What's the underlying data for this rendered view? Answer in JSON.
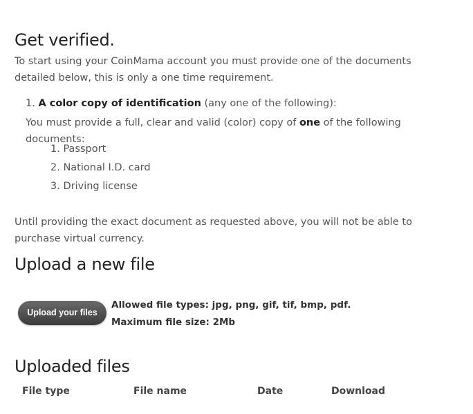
{
  "verify": {
    "title": "Get verified.",
    "intro": "To start using your CoinMama account you must provide one of the documents detailed below, this is only a one time requirement.",
    "requirement": {
      "number": "1.",
      "heading": "A color copy of identification",
      "heading_suffix": " (any one of the following):",
      "line_prefix": "You must provide a full, clear and valid (color) copy of ",
      "line_emphasis": "one",
      "line_suffix": " of the following documents:"
    },
    "documents": [
      {
        "number": "1.",
        "label": "Passport"
      },
      {
        "number": "2.",
        "label": "National I.D. card"
      },
      {
        "number": "3.",
        "label": "Driving license"
      }
    ],
    "notice": "Until providing the exact document as requested above, you will not be able to purchase virtual currency."
  },
  "upload": {
    "title": "Upload a new file",
    "button_label": "Upload your files",
    "allowed_types": "Allowed file types: jpg, png, gif, tif, bmp, pdf.",
    "max_size": "Maximum file size: 2Mb"
  },
  "uploaded": {
    "title": "Uploaded files",
    "columns": [
      "File type",
      "File name",
      "Date",
      "Download"
    ]
  }
}
